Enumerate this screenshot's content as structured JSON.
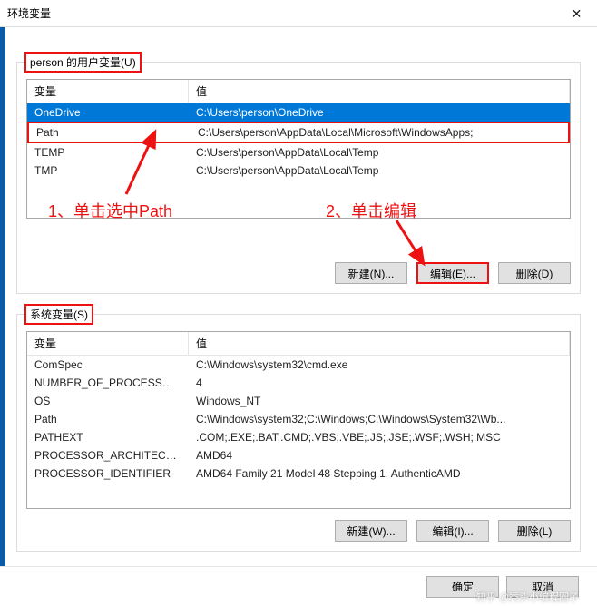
{
  "window": {
    "title": "环境变量",
    "close_glyph": "✕"
  },
  "user_vars": {
    "group_label": "person 的用户变量(U)",
    "header_var": "变量",
    "header_val": "值",
    "rows": [
      {
        "var": "OneDrive",
        "val": "C:\\Users\\person\\OneDrive"
      },
      {
        "var": "Path",
        "val": "C:\\Users\\person\\AppData\\Local\\Microsoft\\WindowsApps;"
      },
      {
        "var": "TEMP",
        "val": "C:\\Users\\person\\AppData\\Local\\Temp"
      },
      {
        "var": "TMP",
        "val": "C:\\Users\\person\\AppData\\Local\\Temp"
      }
    ],
    "buttons": {
      "new": "新建(N)...",
      "edit": "编辑(E)...",
      "delete": "删除(D)"
    }
  },
  "sys_vars": {
    "group_label": "系统变量(S)",
    "header_var": "变量",
    "header_val": "值",
    "rows": [
      {
        "var": "ComSpec",
        "val": "C:\\Windows\\system32\\cmd.exe"
      },
      {
        "var": "NUMBER_OF_PROCESSORS",
        "val": "4"
      },
      {
        "var": "OS",
        "val": "Windows_NT"
      },
      {
        "var": "Path",
        "val": "C:\\Windows\\system32;C:\\Windows;C:\\Windows\\System32\\Wb..."
      },
      {
        "var": "PATHEXT",
        "val": ".COM;.EXE;.BAT;.CMD;.VBS;.VBE;.JS;.JSE;.WSF;.WSH;.MSC"
      },
      {
        "var": "PROCESSOR_ARCHITECTURE",
        "val": "AMD64"
      },
      {
        "var": "PROCESSOR_IDENTIFIER",
        "val": "AMD64 Family 21 Model 48 Stepping 1, AuthenticAMD"
      }
    ],
    "buttons": {
      "new": "新建(W)...",
      "edit": "编辑(I)...",
      "delete": "删除(L)"
    }
  },
  "annotations": {
    "ann1": "1、单击选中Path",
    "ann2": "2、单击编辑"
  },
  "footer": {
    "ok": "确定",
    "cancel": "取消"
  },
  "watermark": "知乎 @秃头小编程圈子"
}
